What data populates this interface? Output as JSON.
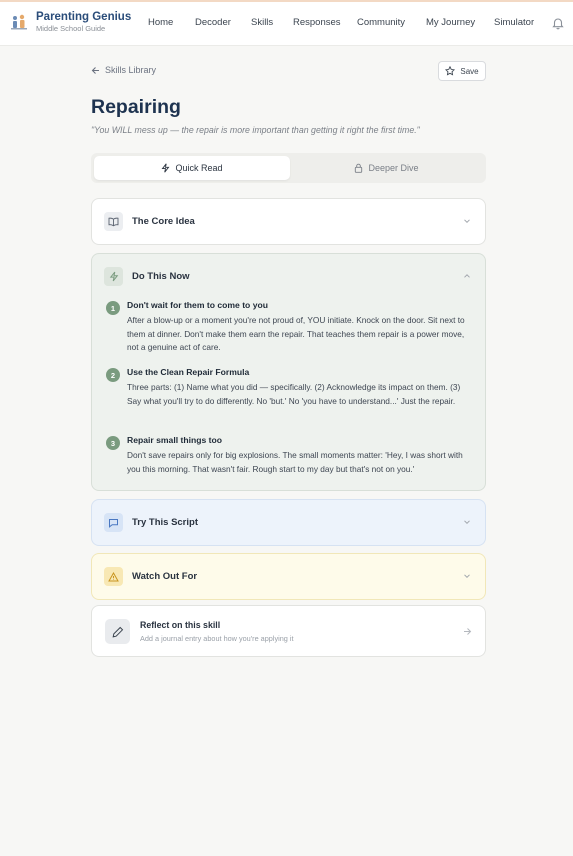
{
  "brand": {
    "name": "Parenting Genius",
    "subtitle": "Middle School Guide"
  },
  "nav": {
    "items": [
      "Home",
      "Decoder",
      "Skills",
      "Responses",
      "Community",
      "My Journey",
      "Simulator"
    ]
  },
  "header": {
    "back_label": "Skills Library",
    "save_label": "Save"
  },
  "page": {
    "title": "Repairing",
    "quote": "\"You WILL mess up — the repair is more important than getting it right the first time.\""
  },
  "tabs": {
    "quick_read": "Quick Read",
    "deeper_dive": "Deeper Dive",
    "active": "Quick Read"
  },
  "sections": {
    "core": {
      "title": "The Core Idea",
      "expanded": false
    },
    "now": {
      "title": "Do This Now",
      "expanded": true,
      "steps": [
        {
          "num": "1",
          "title": "Don't wait for them to come to you",
          "body": "After a blow-up or a moment you're not proud of, YOU initiate. Knock on the door. Sit next to them at dinner. Don't make them earn the repair. That teaches them repair is a power move, not a genuine act of care."
        },
        {
          "num": "2",
          "title": "Use the Clean Repair Formula",
          "body": "Three parts: (1) Name what you did — specifically. (2) Acknowledge its impact on them. (3) Say what you'll try to do differently. No 'but.' No 'you have to understand...' Just the repair."
        },
        {
          "num": "3",
          "title": "Repair small things too",
          "body": "Don't save repairs only for big explosions. The small moments matter: 'Hey, I was short with you this morning. That wasn't fair. Rough start to my day but that's not on you.'"
        }
      ]
    },
    "script": {
      "title": "Try This Script",
      "expanded": false
    },
    "watch": {
      "title": "Watch Out For",
      "expanded": false
    }
  },
  "reflect": {
    "title": "Reflect on this skill",
    "subtitle": "Add a journal entry about how you're applying it"
  },
  "colors": {
    "brand": "#2b4d7a",
    "step_badge": "#7a9b7f",
    "script_bg": "#edf3fb",
    "watch_bg": "#fefbea",
    "now_bg": "#eef2ee"
  },
  "icons": {
    "logo": "family-logo-icon",
    "bell": "bell-icon",
    "back": "arrow-left-icon",
    "save": "star-icon",
    "quick": "lightning-icon",
    "deeper": "lock-icon",
    "core": "book-open-icon",
    "now": "lightning-icon",
    "script": "chat-bubble-icon",
    "watch": "warning-triangle-icon",
    "reflect": "pen-icon",
    "go": "arrow-right-icon"
  }
}
